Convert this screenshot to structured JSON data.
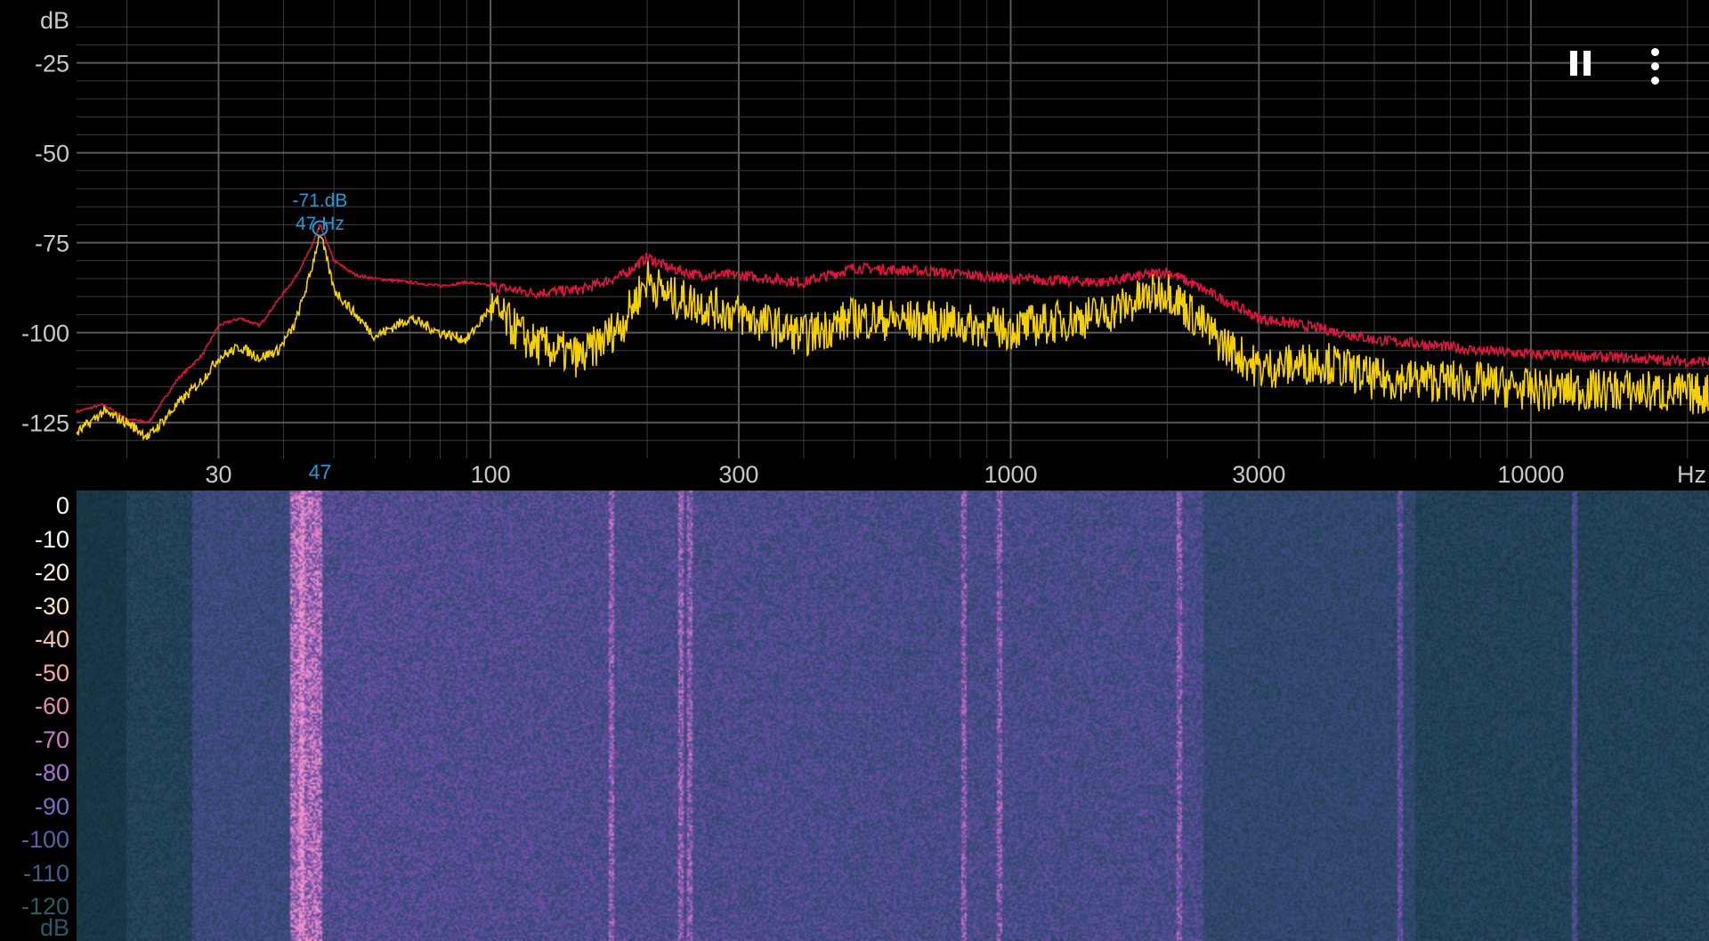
{
  "spectrum": {
    "y_unit": "dB",
    "y_ticks": [
      "-25",
      "-50",
      "-75",
      "-100",
      "-125"
    ],
    "x_unit": "Hz",
    "x_ticks": [
      "30",
      "100",
      "300",
      "1000",
      "3000",
      "10000"
    ],
    "peak_marker": {
      "db_label": "-71.dB",
      "hz_label": "47.Hz",
      "axis_label": "47"
    },
    "colors": {
      "grid": "#3c3c3c",
      "axis_text": "#c8c8c8",
      "live_trace": "#f5d000",
      "peak_hold_trace": "#e0143c",
      "marker": "#1e9bd7"
    }
  },
  "spectrogram": {
    "scale_labels": [
      "0",
      "-10",
      "-20",
      "-30",
      "-40",
      "-50",
      "-60",
      "-70",
      "-80",
      "-90",
      "-100",
      "-110",
      "-120"
    ],
    "scale_unit": "dB",
    "scale_colors": [
      "#ffffff",
      "#ffffff",
      "#fff1d8",
      "#ffe2c0",
      "#ffc4a8",
      "#f7a6a4",
      "#e58cb6",
      "#c97dc8",
      "#a773d3",
      "#8068c6",
      "#5860a6",
      "#3e5f86",
      "#2b5a66"
    ]
  },
  "toolbar": {
    "pause_icon": "pause-icon",
    "menu_icon": "more-vert-icon"
  },
  "chart_data": {
    "type": "line",
    "x_scale": "log",
    "xlabel": "Hz",
    "ylabel": "dB",
    "xlim": [
      16,
      22000
    ],
    "ylim": [
      -135,
      -10
    ],
    "grid": true,
    "x": [
      16,
      18,
      20,
      22,
      25,
      28,
      30,
      33,
      36,
      39,
      42,
      45,
      47,
      50,
      55,
      60,
      70,
      80,
      90,
      100,
      120,
      150,
      180,
      200,
      220,
      250,
      300,
      400,
      500,
      700,
      1000,
      1500,
      2000,
      2500,
      3000,
      4000,
      5000,
      6000,
      8000,
      10000,
      15000,
      20000
    ],
    "series": [
      {
        "values": [
          -128,
          -122,
          -125,
          -129,
          -120,
          -113,
          -107,
          -104,
          -107,
          -105,
          -98,
          -84,
          -72,
          -88,
          -95,
          -101,
          -96,
          -100,
          -102,
          -93,
          -103,
          -107,
          -97,
          -85,
          -90,
          -92,
          -95,
          -101,
          -96,
          -97,
          -99,
          -95,
          -88,
          -102,
          -110,
          -108,
          -113,
          -113,
          -114,
          -116,
          -116,
          -117
        ]
      },
      {
        "values": [
          -122,
          -120,
          -124,
          -125,
          -113,
          -106,
          -98,
          -96,
          -98,
          -91,
          -85,
          -77,
          -70,
          -80,
          -84,
          -85,
          -86,
          -87,
          -86,
          -87,
          -89,
          -88,
          -84,
          -79,
          -82,
          -84,
          -84,
          -86,
          -82,
          -83,
          -85,
          -86,
          -83,
          -90,
          -96,
          -99,
          -102,
          -103,
          -105,
          -106,
          -107,
          -108
        ]
      }
    ]
  }
}
